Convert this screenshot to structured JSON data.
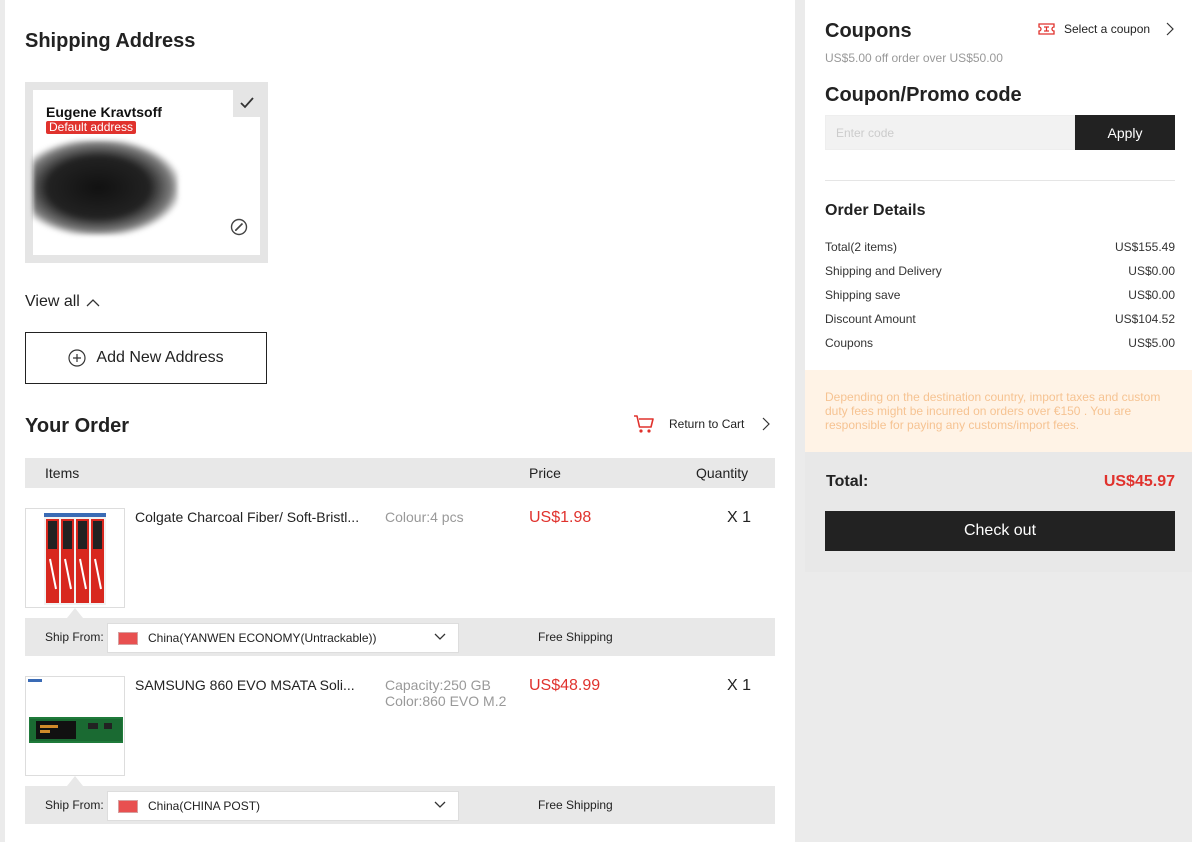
{
  "shipping": {
    "title": "Shipping Address",
    "address": {
      "name": "Eugene Kravtsoff",
      "badge": "Default address"
    },
    "view_all": "View all",
    "add_new": "Add New Address"
  },
  "order": {
    "title": "Your Order",
    "return_to_cart": "Return to Cart",
    "columns": {
      "items": "Items",
      "price": "Price",
      "quantity": "Quantity"
    },
    "items": [
      {
        "name": "Colgate Charcoal Fiber/ Soft-Bristl...",
        "attrs": [
          "Colour:4 pcs"
        ],
        "price": "US$1.98",
        "quantity": "X 1",
        "ship_from_label": "Ship From:",
        "ship_method": "China(YANWEN ECONOMY(Untrackable))",
        "shipping_cost": "Free Shipping"
      },
      {
        "name": "SAMSUNG 860 EVO MSATA Soli...",
        "attrs": [
          "Capacity:250 GB",
          "Color:860 EVO M.2"
        ],
        "price": "US$48.99",
        "quantity": "X 1",
        "ship_from_label": "Ship From:",
        "ship_method": "China(CHINA POST)",
        "shipping_cost": "Free Shipping"
      }
    ]
  },
  "coupons": {
    "title": "Coupons",
    "select_label": "Select a coupon",
    "subtitle": "US$5.00 off order over US$50.00"
  },
  "promo": {
    "title": "Coupon/Promo code",
    "placeholder": "Enter code",
    "apply_label": "Apply"
  },
  "order_details": {
    "title": "Order Details",
    "rows": [
      {
        "label": "Total(2 items)",
        "value": "US$155.49"
      },
      {
        "label": "Shipping and Delivery",
        "value": "US$0.00"
      },
      {
        "label": "Shipping save",
        "value": "US$0.00"
      },
      {
        "label": "Discount Amount",
        "value": "US$104.52"
      },
      {
        "label": "Coupons",
        "value": "US$5.00"
      }
    ]
  },
  "notice": "Depending on the destination country, import taxes and custom duty fees might be incurred on orders over €150 . You are responsible for paying any customs/import fees.",
  "total": {
    "label": "Total:",
    "value": "US$45.97"
  },
  "checkout_label": "Check out",
  "colors": {
    "accent_red": "#e0322d",
    "dark_button": "#222222",
    "notice_bg": "#fff3e6",
    "notice_text": "#f6c392"
  }
}
